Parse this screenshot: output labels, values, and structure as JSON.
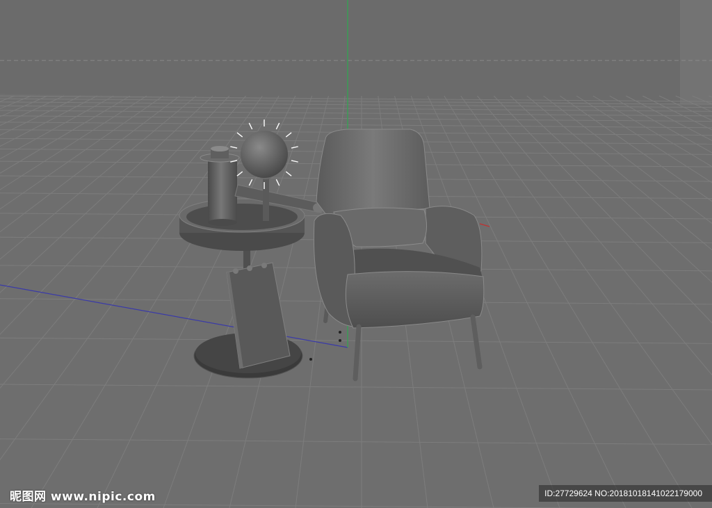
{
  "viewport": {
    "background_color": "#6b6b6b",
    "floor_color": "#6e6e6e",
    "grid_color": "#7d7d7d",
    "right_panel_color": "#737373",
    "horizon_line_color": "#888888",
    "y_axis_color": "#2fa84f",
    "x_axis_color": "#3a3aa8",
    "z_axis_color": "#c03030",
    "objects": [
      {
        "name": "armchair",
        "icon": "armchair-icon"
      },
      {
        "name": "side-table",
        "icon": "round-table-icon"
      },
      {
        "name": "sphere-light",
        "icon": "bulb-icon"
      },
      {
        "name": "bottle",
        "icon": "cylinder-icon"
      },
      {
        "name": "tablet",
        "icon": "tablet-icon"
      }
    ]
  },
  "watermark": {
    "logo_text": "昵图网 www.nipic.com",
    "id_text": "ID:27729624 NO:20181018141022179000"
  }
}
